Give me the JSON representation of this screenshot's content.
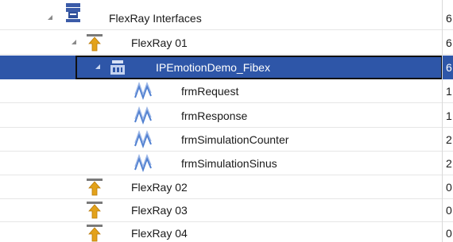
{
  "tree": {
    "rows": [
      {
        "label": "FlexRay Interfaces",
        "value": "6",
        "icon": "flexray-interfaces-icon"
      },
      {
        "label": "FlexRay 01",
        "value": "6",
        "icon": "flexray-channel-icon"
      },
      {
        "label": "IPEmotionDemo_Fibex",
        "value": "6",
        "icon": "fibex-database-icon"
      },
      {
        "label": "frmRequest",
        "value": "1",
        "icon": "frame-signal-icon"
      },
      {
        "label": "frmResponse",
        "value": "1",
        "icon": "frame-signal-icon"
      },
      {
        "label": "frmSimulationCounter",
        "value": "2",
        "icon": "frame-signal-icon"
      },
      {
        "label": "frmSimulationSinus",
        "value": "2",
        "icon": "frame-signal-icon"
      },
      {
        "label": "FlexRay 02",
        "value": "0",
        "icon": "flexray-channel-icon"
      },
      {
        "label": "FlexRay 03",
        "value": "0",
        "icon": "flexray-channel-icon"
      },
      {
        "label": "FlexRay 04",
        "value": "0",
        "icon": "flexray-channel-icon"
      }
    ],
    "colors": {
      "selection": "#2e56a8",
      "signal_wave": "#4f7fd0",
      "channel_arrow": "#e3a21a"
    }
  }
}
